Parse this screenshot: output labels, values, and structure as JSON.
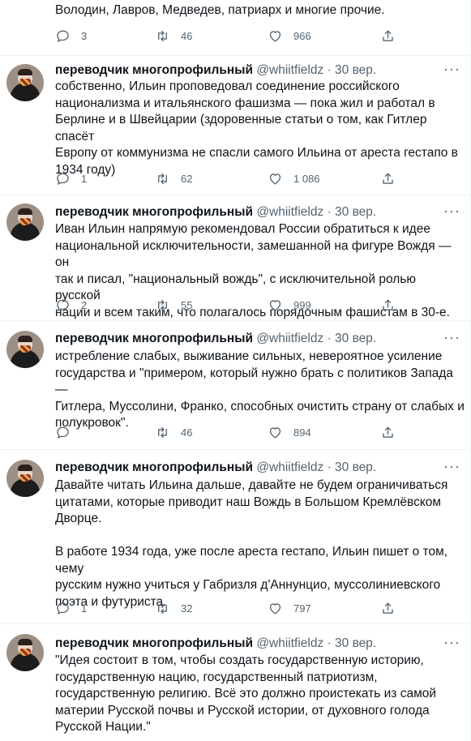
{
  "partial_tweet": {
    "text": "Володин, Лавров, Медведев, патриарх и многие прочие.",
    "replies": "3",
    "retweets": "46",
    "likes": "966"
  },
  "author": {
    "name": "переводчик многопрофильный",
    "handle": "@whiitfieldz",
    "separator": "·"
  },
  "tweets": [
    {
      "date": "30 вер.",
      "text": "собственно, Ильин проповедовал соединение российского\nнационализма и итальянского фашизма — пока жил и работал в\nБерлине и в Швейцарии (здоровенные статьи о том, как Гитлер спасёт\nЕвропу от коммунизма не спасли самого Ильина от ареста гестапо в\n1934 году)",
      "replies": "1",
      "retweets": "62",
      "likes": "1 086"
    },
    {
      "date": "30 вер.",
      "text": "Иван Ильин напрямую рекомендовал России обратиться к идее\nнациональной исключительности, замешанной на фигуре Вождя — он\nтак и писал, \"национальный вождь\", с исключительной ролью русской\nнации и всем таким, что полагалось порядочным фашистам в 30-е.",
      "replies": "2",
      "retweets": "55",
      "likes": "999"
    },
    {
      "date": "30 вер.",
      "text": "истребление слабых, выживание сильных, невероятное усиление\nгосударства и \"примером, который нужно брать с политиков Запада —\nГитлера, Муссолини, Франко, способных очистить страну от слабых и\nполукровок\".",
      "replies": "",
      "retweets": "46",
      "likes": "894"
    },
    {
      "date": "30 вер.",
      "text": "Давайте читать Ильина дальше, давайте не будем ограничиваться\nцитатами, которые приводит наш Вождь в Большом Кремлёвском\nДворце.\n\nВ работе 1934 года, уже после ареста гестапо, Ильин пишет о том, чему\nрусским нужно учиться у Габризля д'Аннунцио, муссолиниевского\nпоэта и футуриста.",
      "replies": "1",
      "retweets": "32",
      "likes": "797"
    },
    {
      "date": "30 вер.",
      "text": "\"Идея состоит в том, чтобы создать государственную историю,\nгосударственную нацию, государственный патриотизм,\nгосударственную религию. Всё это должно проистекать из самой\nматерии Русской почвы и Русской истории, от духовного голода\nРусской Нации.\""
    }
  ],
  "icons": [
    "reply-icon",
    "retweet-icon",
    "like-icon",
    "share-icon",
    "more-icon"
  ],
  "colors": {
    "text": "#0f1419",
    "secondary": "#536471",
    "divider": "#eff3f4"
  }
}
